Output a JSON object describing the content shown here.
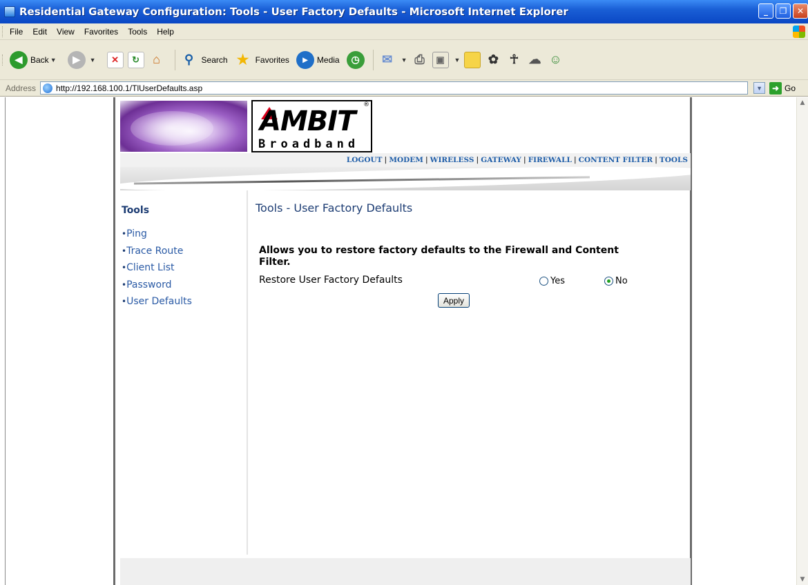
{
  "window": {
    "title": "Residential Gateway Configuration: Tools - User Factory Defaults - Microsoft Internet Explorer",
    "controls": [
      "_",
      "❐",
      "✕"
    ]
  },
  "menubar": {
    "items": [
      "File",
      "Edit",
      "View",
      "Favorites",
      "Tools",
      "Help"
    ]
  },
  "toolbar": {
    "back_label": "Back",
    "search_label": "Search",
    "favorites_label": "Favorites",
    "media_label": "Media"
  },
  "addressbar": {
    "label": "Address",
    "url": "http://192.168.100.1/TlUserDefaults.asp",
    "go_label": "Go"
  },
  "logo": {
    "brand": "AMBIT",
    "sub": "Broadband",
    "reg": "®"
  },
  "nav": {
    "links": [
      "LOGOUT",
      "MODEM",
      "WIRELESS",
      "GATEWAY",
      "FIREWALL",
      "CONTENT FILTER",
      "TOOLS"
    ],
    "separator": "|"
  },
  "sidebar": {
    "title": "Tools",
    "items": [
      "Ping",
      "Trace Route",
      "Client List",
      "Password",
      "User Defaults"
    ]
  },
  "main": {
    "title": "Tools - User Factory Defaults",
    "description": "Allows you to restore factory defaults to the Firewall and Content Filter.",
    "row_label": "Restore User Factory Defaults",
    "option_yes": "Yes",
    "option_no": "No",
    "selected": "No",
    "apply_label": "Apply"
  },
  "colors": {
    "titlebar": "#0a47c4",
    "chrome": "#ece9d8",
    "link": "#2a5aa5",
    "heading": "#1c3c73"
  }
}
